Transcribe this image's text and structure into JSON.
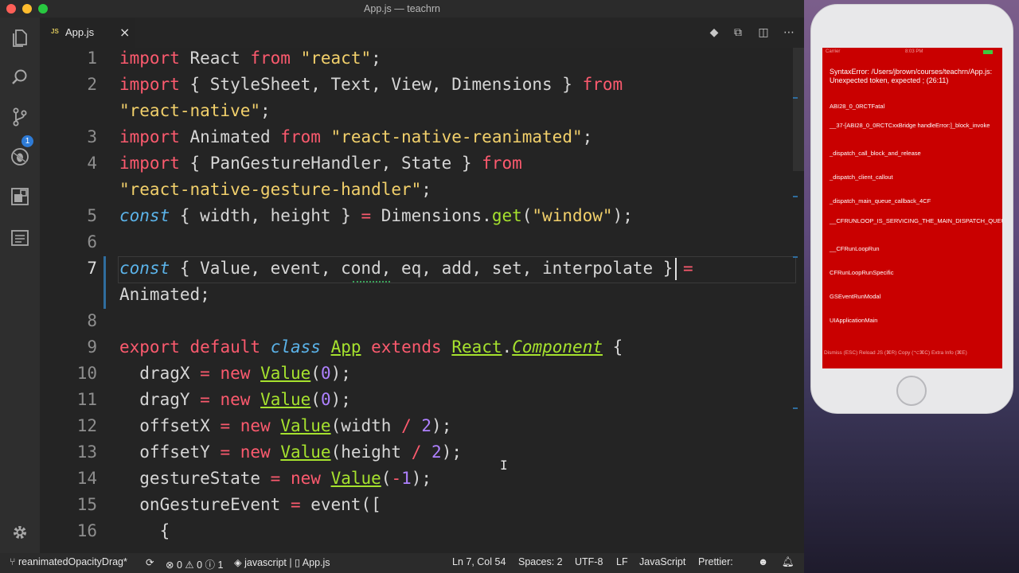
{
  "window": {
    "title": "App.js — teachrn"
  },
  "activity": {
    "scm_badge": "1"
  },
  "tab": {
    "icon": "JS",
    "label": "App.js",
    "close": "×"
  },
  "tab_actions": [
    "compare-icon",
    "open-preview-icon",
    "split-editor-icon",
    "more-icon"
  ],
  "code": [
    {
      "num": "1",
      "tokens": [
        [
          "kw",
          "import"
        ],
        [
          "pl",
          " React "
        ],
        [
          "kw",
          "from"
        ],
        [
          "pl",
          " "
        ],
        [
          "st",
          "\"react\""
        ],
        [
          "pl",
          ";"
        ]
      ]
    },
    {
      "num": "2",
      "tokens": [
        [
          "kw",
          "import"
        ],
        [
          "pl",
          " { StyleSheet, Text, View, Dimensions } "
        ],
        [
          "kw",
          "from"
        ]
      ]
    },
    {
      "num": "",
      "tokens": [
        [
          "st",
          "\"react-native\""
        ],
        [
          "pl",
          ";"
        ]
      ]
    },
    {
      "num": "3",
      "tokens": [
        [
          "kw",
          "import"
        ],
        [
          "pl",
          " Animated "
        ],
        [
          "kw",
          "from"
        ],
        [
          "pl",
          " "
        ],
        [
          "st",
          "\"react-native-reanimated\""
        ],
        [
          "pl",
          ";"
        ]
      ]
    },
    {
      "num": "4",
      "tokens": [
        [
          "kw",
          "import"
        ],
        [
          "pl",
          " { PanGestureHandler, State } "
        ],
        [
          "kw",
          "from"
        ]
      ]
    },
    {
      "num": "",
      "tokens": [
        [
          "st",
          "\"react-native-gesture-handler\""
        ],
        [
          "pl",
          ";"
        ]
      ]
    },
    {
      "num": "5",
      "tokens": [
        [
          "it",
          "const"
        ],
        [
          "pl",
          " { width, height } "
        ],
        [
          "op",
          "="
        ],
        [
          "pl",
          " Dimensions."
        ],
        [
          "mth",
          "get"
        ],
        [
          "pl",
          "("
        ],
        [
          "st",
          "\"window\""
        ],
        [
          "pl",
          ");"
        ]
      ]
    },
    {
      "num": "6",
      "tokens": []
    },
    {
      "num": "7",
      "tokens": [
        [
          "it",
          "const"
        ],
        [
          "pl",
          " { Value, event, cond, eq, add, set, interpolate } "
        ],
        [
          "op",
          "="
        ]
      ]
    },
    {
      "num": "",
      "tokens": [
        [
          "pl",
          "Animated;"
        ]
      ]
    },
    {
      "num": "8",
      "tokens": []
    },
    {
      "num": "9",
      "tokens": [
        [
          "kw",
          "export"
        ],
        [
          "pl",
          " "
        ],
        [
          "kw",
          "default"
        ],
        [
          "pl",
          " "
        ],
        [
          "it",
          "class"
        ],
        [
          "pl",
          " "
        ],
        [
          "fn ul",
          "App"
        ],
        [
          "pl",
          " "
        ],
        [
          "kw",
          "extends"
        ],
        [
          "pl",
          " "
        ],
        [
          "fn ul",
          "React"
        ],
        [
          "pl",
          "."
        ],
        [
          "cls ul",
          "Component"
        ],
        [
          "pl",
          " {"
        ]
      ]
    },
    {
      "num": "10",
      "tokens": [
        [
          "pl",
          "  dragX "
        ],
        [
          "op",
          "="
        ],
        [
          "pl",
          " "
        ],
        [
          "kw",
          "new"
        ],
        [
          "pl",
          " "
        ],
        [
          "fn ul",
          "Value"
        ],
        [
          "pl",
          "("
        ],
        [
          "nm",
          "0"
        ],
        [
          "pl",
          ");"
        ]
      ]
    },
    {
      "num": "11",
      "tokens": [
        [
          "pl",
          "  dragY "
        ],
        [
          "op",
          "="
        ],
        [
          "pl",
          " "
        ],
        [
          "kw",
          "new"
        ],
        [
          "pl",
          " "
        ],
        [
          "fn ul",
          "Value"
        ],
        [
          "pl",
          "("
        ],
        [
          "nm",
          "0"
        ],
        [
          "pl",
          ");"
        ]
      ]
    },
    {
      "num": "12",
      "tokens": [
        [
          "pl",
          "  offsetX "
        ],
        [
          "op",
          "="
        ],
        [
          "pl",
          " "
        ],
        [
          "kw",
          "new"
        ],
        [
          "pl",
          " "
        ],
        [
          "fn ul",
          "Value"
        ],
        [
          "pl",
          "(width "
        ],
        [
          "op",
          "/"
        ],
        [
          "pl",
          " "
        ],
        [
          "nm",
          "2"
        ],
        [
          "pl",
          ");"
        ]
      ]
    },
    {
      "num": "13",
      "tokens": [
        [
          "pl",
          "  offsetY "
        ],
        [
          "op",
          "="
        ],
        [
          "pl",
          " "
        ],
        [
          "kw",
          "new"
        ],
        [
          "pl",
          " "
        ],
        [
          "fn ul",
          "Value"
        ],
        [
          "pl",
          "(height "
        ],
        [
          "op",
          "/"
        ],
        [
          "pl",
          " "
        ],
        [
          "nm",
          "2"
        ],
        [
          "pl",
          ");"
        ]
      ]
    },
    {
      "num": "14",
      "tokens": [
        [
          "pl",
          "  gestureState "
        ],
        [
          "op",
          "="
        ],
        [
          "pl",
          " "
        ],
        [
          "kw",
          "new"
        ],
        [
          "pl",
          " "
        ],
        [
          "fn ul",
          "Value"
        ],
        [
          "pl",
          "("
        ],
        [
          "op",
          "-"
        ],
        [
          "nm",
          "1"
        ],
        [
          "pl",
          ");"
        ]
      ]
    },
    {
      "num": "15",
      "tokens": [
        [
          "pl",
          "  onGestureEvent "
        ],
        [
          "op",
          "="
        ],
        [
          "pl",
          " event(["
        ]
      ]
    },
    {
      "num": "16",
      "tokens": [
        [
          "pl",
          "    {"
        ]
      ]
    }
  ],
  "active_line": "7",
  "statusbar": {
    "branch": "reanimatedOpacityDrag*",
    "errors": "0",
    "warnings": "0",
    "info": "1",
    "language_file": "javascript | ",
    "file": "App.js",
    "position": "Ln 7, Col 54",
    "spaces": "Spaces: 2",
    "encoding": "UTF-8",
    "eol": "LF",
    "language": "JavaScript",
    "formatter": "Prettier:"
  },
  "simulator": {
    "status_left": "Carrier",
    "status_time": "8:03 PM",
    "error": "SyntaxError: /Users/jbrown/courses/teachrn/App.js: Unexpected token, expected ; (26:11)",
    "stack": [
      "ABI28_0_0RCTFatal",
      "__37-[ABI28_0_0RCTCxxBridge handleError:]_block_invoke",
      "_dispatch_call_block_and_release",
      "_dispatch_client_callout",
      "_dispatch_main_queue_callback_4CF",
      "__CFRUNLOOP_IS_SERVICING_THE_MAIN_DISPATCH_QUEUE__",
      "__CFRunLoopRun",
      "CFRunLoopRunSpecific",
      "GSEventRunModal",
      "UIApplicationMain"
    ],
    "footer": "Dismiss (ESC)   Reload JS (⌘R)   Copy (⌥⌘C)   Extra Info (⌘E)"
  },
  "colors": {
    "keyword": "#fc5a6e",
    "string": "#f2d06b",
    "storage": "#5bb3e9",
    "class": "#a6e22e",
    "number": "#ae81ff",
    "error_bg": "#c90000"
  }
}
